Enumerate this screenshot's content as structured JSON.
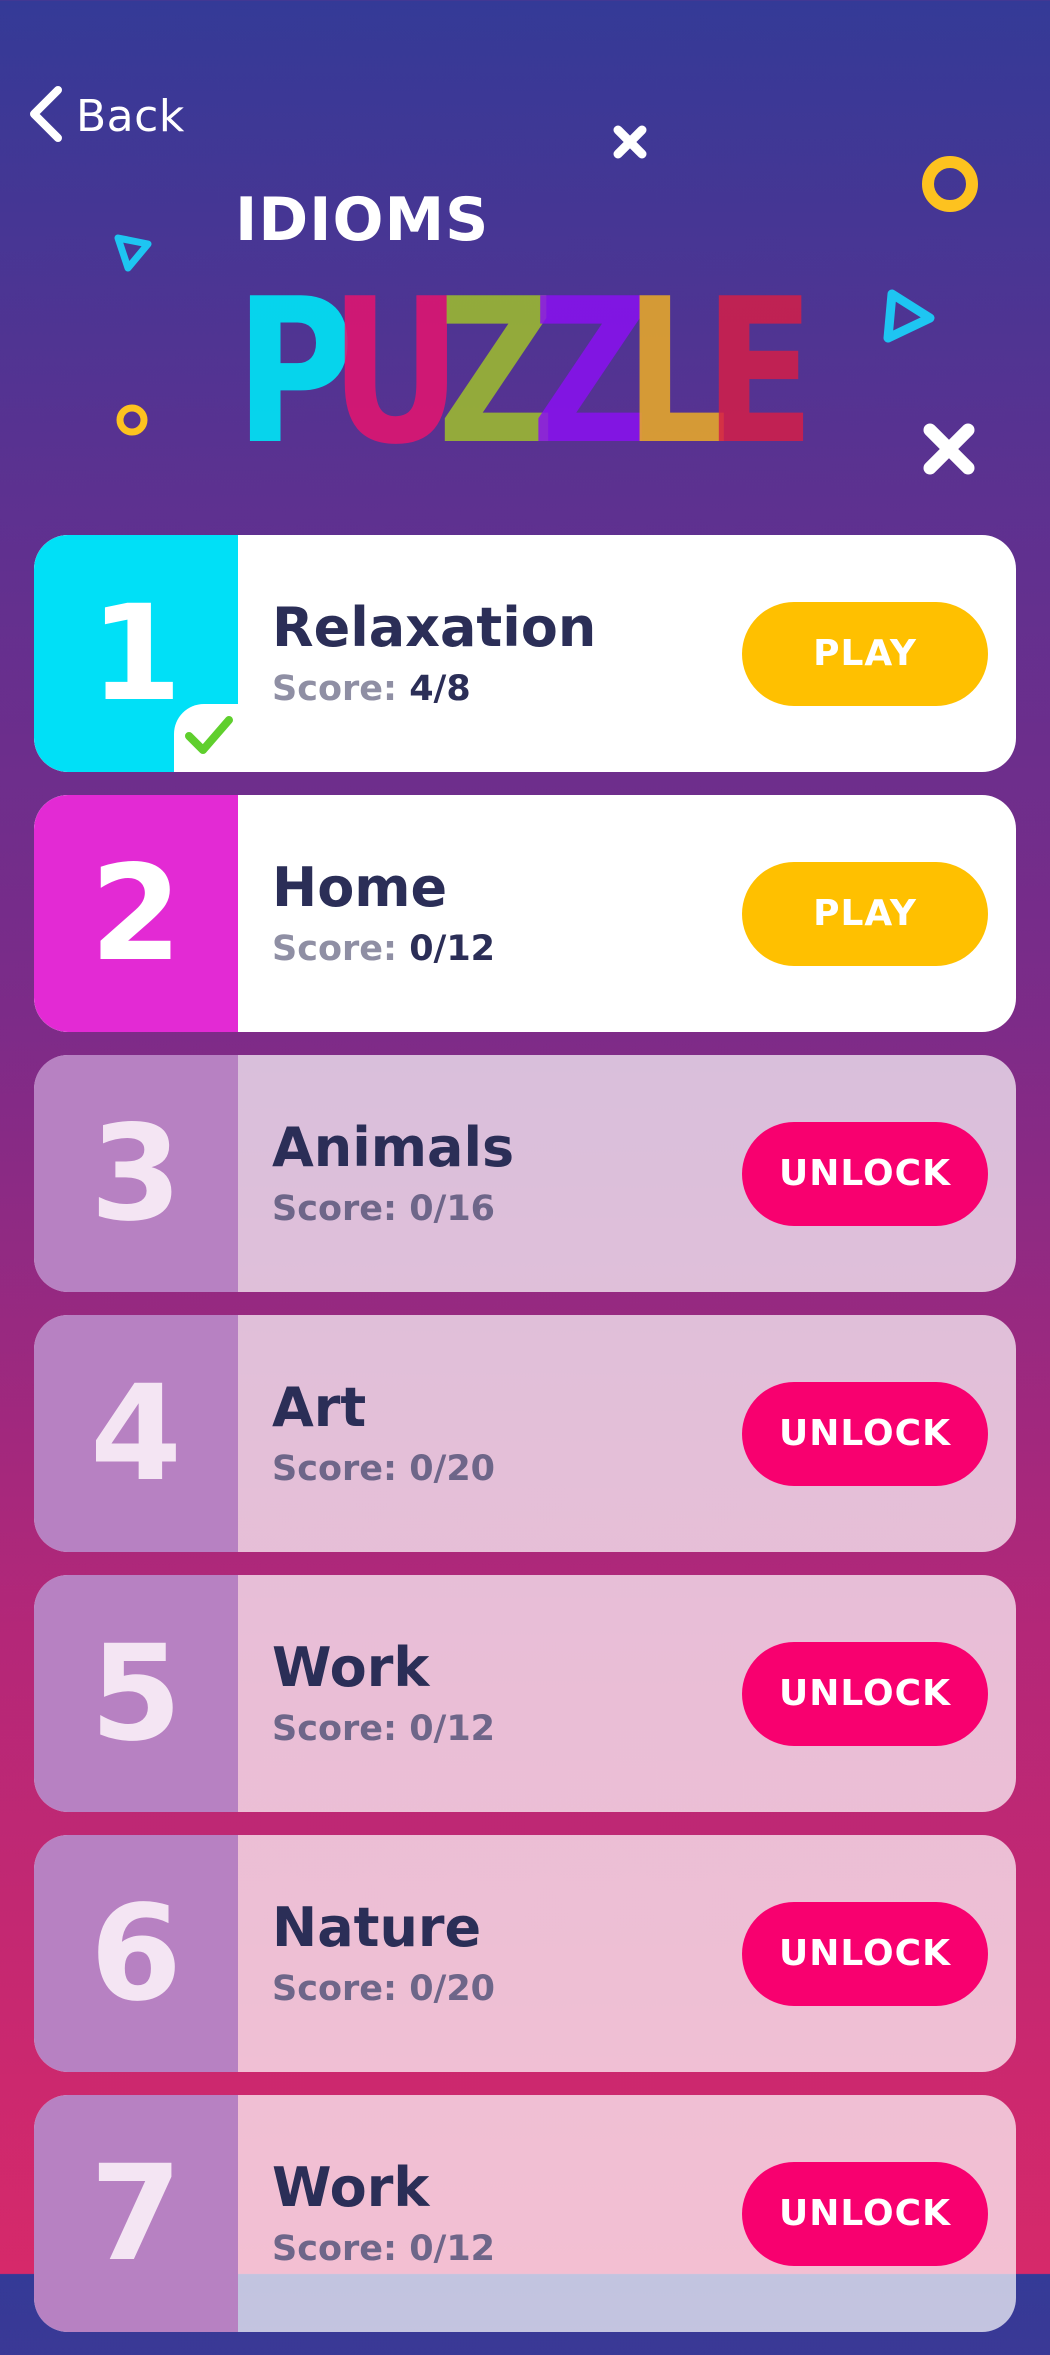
{
  "nav": {
    "back_label": "Back"
  },
  "logo": {
    "line1": "IDIOMS",
    "line2": "PUZZLE"
  },
  "colors": {
    "cyan": "#00e0f7",
    "magenta": "#e32ad4",
    "play": "#ffc000",
    "unlock": "#f8006f",
    "locked_panel": "#b781c2",
    "title": "#2b2e57"
  },
  "levels": [
    {
      "number": "1",
      "title": "Relaxation",
      "score_label": "Score:",
      "score_value": "4/8",
      "button": "PLAY",
      "panel_color": "#00e0f7",
      "completed": true
    },
    {
      "number": "2",
      "title": "Home",
      "score_label": "Score:",
      "score_value": "0/12",
      "button": "PLAY",
      "panel_color": "#e32ad4",
      "completed": false
    },
    {
      "number": "3",
      "title": "Animals",
      "score_label": "Score:",
      "score_value": "0/16",
      "button": "UNLOCK"
    },
    {
      "number": "4",
      "title": "Art",
      "score_label": "Score:",
      "score_value": "0/20",
      "button": "UNLOCK"
    },
    {
      "number": "5",
      "title": "Work",
      "score_label": "Score:",
      "score_value": "0/12",
      "button": "UNLOCK"
    },
    {
      "number": "6",
      "title": "Nature",
      "score_label": "Score:",
      "score_value": "0/20",
      "button": "UNLOCK"
    },
    {
      "number": "7",
      "title": "Work",
      "score_label": "Score:",
      "score_value": "0/12",
      "button": "UNLOCK"
    }
  ]
}
